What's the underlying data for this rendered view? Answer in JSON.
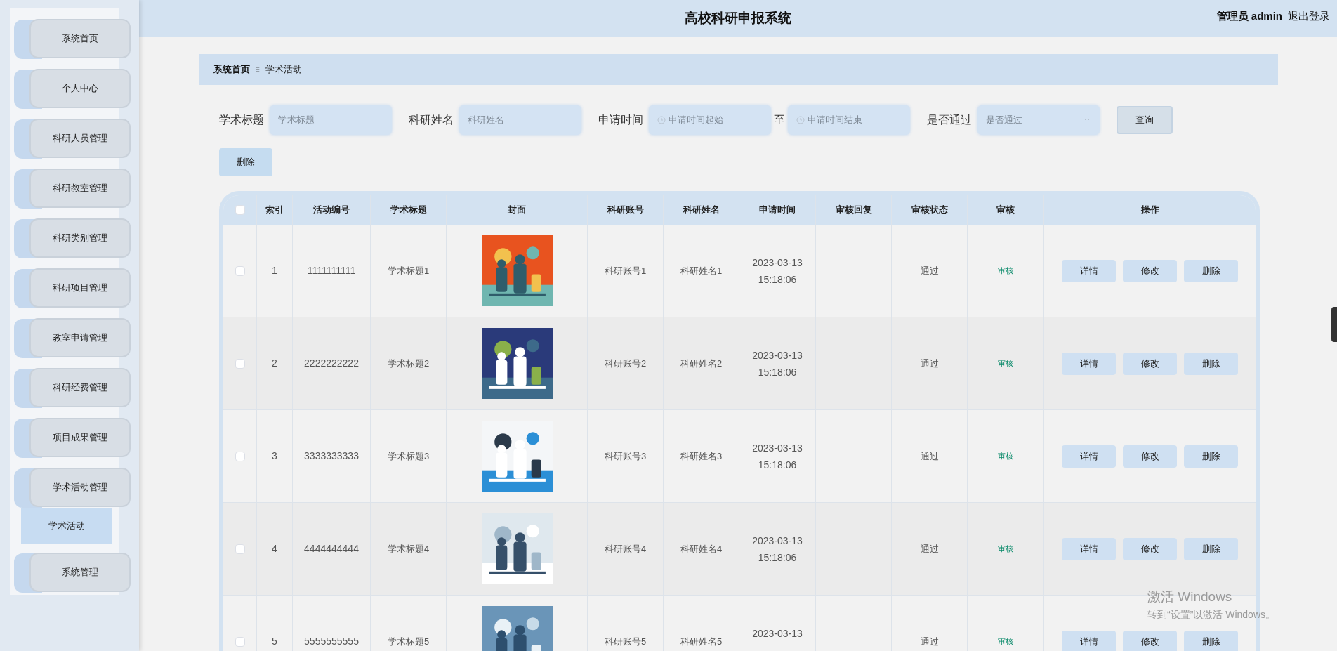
{
  "header": {
    "title": "高校科研申报系统",
    "user": "管理员 admin",
    "logout": "退出登录"
  },
  "sidebar": {
    "items": [
      {
        "label": "系统首页"
      },
      {
        "label": "个人中心"
      },
      {
        "label": "科研人员管理"
      },
      {
        "label": "科研教室管理"
      },
      {
        "label": "科研类别管理"
      },
      {
        "label": "科研项目管理"
      },
      {
        "label": "教室申请管理"
      },
      {
        "label": "科研经费管理"
      },
      {
        "label": "项目成果管理"
      },
      {
        "label": "学术活动管理",
        "children": [
          {
            "label": "学术活动",
            "selected": true
          }
        ]
      },
      {
        "label": "系统管理"
      }
    ]
  },
  "breadcrumb": [
    {
      "label": "系统首页"
    },
    {
      "label": "学术活动"
    }
  ],
  "filters": [
    {
      "kind": "text",
      "label": "学术标题",
      "placeholder": "学术标题"
    },
    {
      "kind": "text",
      "label": "科研姓名",
      "placeholder": "科研姓名"
    },
    {
      "kind": "daterange",
      "label": "申请时间",
      "start_placeholder": "申请时间起始",
      "separator": "至",
      "end_placeholder": "申请时间结束"
    },
    {
      "kind": "select",
      "label": "是否通过",
      "placeholder": "是否通过"
    }
  ],
  "search_button": "查询",
  "delete_button": "删除",
  "table": {
    "header_checked": false,
    "columns": [
      "索引",
      "活动编号",
      "学术标题",
      "封面",
      "科研账号",
      "科研姓名",
      "申请时间",
      "审核回复",
      "审核状态",
      "审核",
      "操作"
    ],
    "rows": [
      {
        "checked": false,
        "index": "1",
        "code": "1111111111",
        "title": "学术标题1",
        "account": "科研账号1",
        "name": "科研姓名1",
        "date": "2023-03-13",
        "time": "15:18:06",
        "status": "通过",
        "review": "审核",
        "actions": [
          "详情",
          "修改",
          "删除"
        ]
      },
      {
        "checked": false,
        "index": "2",
        "code": "2222222222",
        "title": "学术标题2",
        "account": "科研账号2",
        "name": "科研姓名2",
        "date": "2023-03-13",
        "time": "15:18:06",
        "status": "通过",
        "review": "审核",
        "actions": [
          "详情",
          "修改",
          "删除"
        ]
      },
      {
        "checked": false,
        "index": "3",
        "code": "3333333333",
        "title": "学术标题3",
        "account": "科研账号3",
        "name": "科研姓名3",
        "date": "2023-03-13",
        "time": "15:18:06",
        "status": "通过",
        "review": "审核",
        "actions": [
          "详情",
          "修改",
          "删除"
        ]
      },
      {
        "checked": false,
        "index": "4",
        "code": "4444444444",
        "title": "学术标题4",
        "account": "科研账号4",
        "name": "科研姓名4",
        "date": "2023-03-13",
        "time": "15:18:06",
        "status": "通过",
        "review": "审核",
        "actions": [
          "详情",
          "修改",
          "删除"
        ]
      },
      {
        "checked": false,
        "index": "5",
        "code": "5555555555",
        "title": "学术标题5",
        "account": "科研账号5",
        "name": "科研姓名5",
        "date": "2023-03-13",
        "status": "通过",
        "review": "审核",
        "actions": [
          "详情",
          "修改",
          "删除"
        ]
      }
    ]
  },
  "os_notice": {
    "title": "激活 Windows",
    "text": "转到“设置”以激活 Windows。"
  }
}
